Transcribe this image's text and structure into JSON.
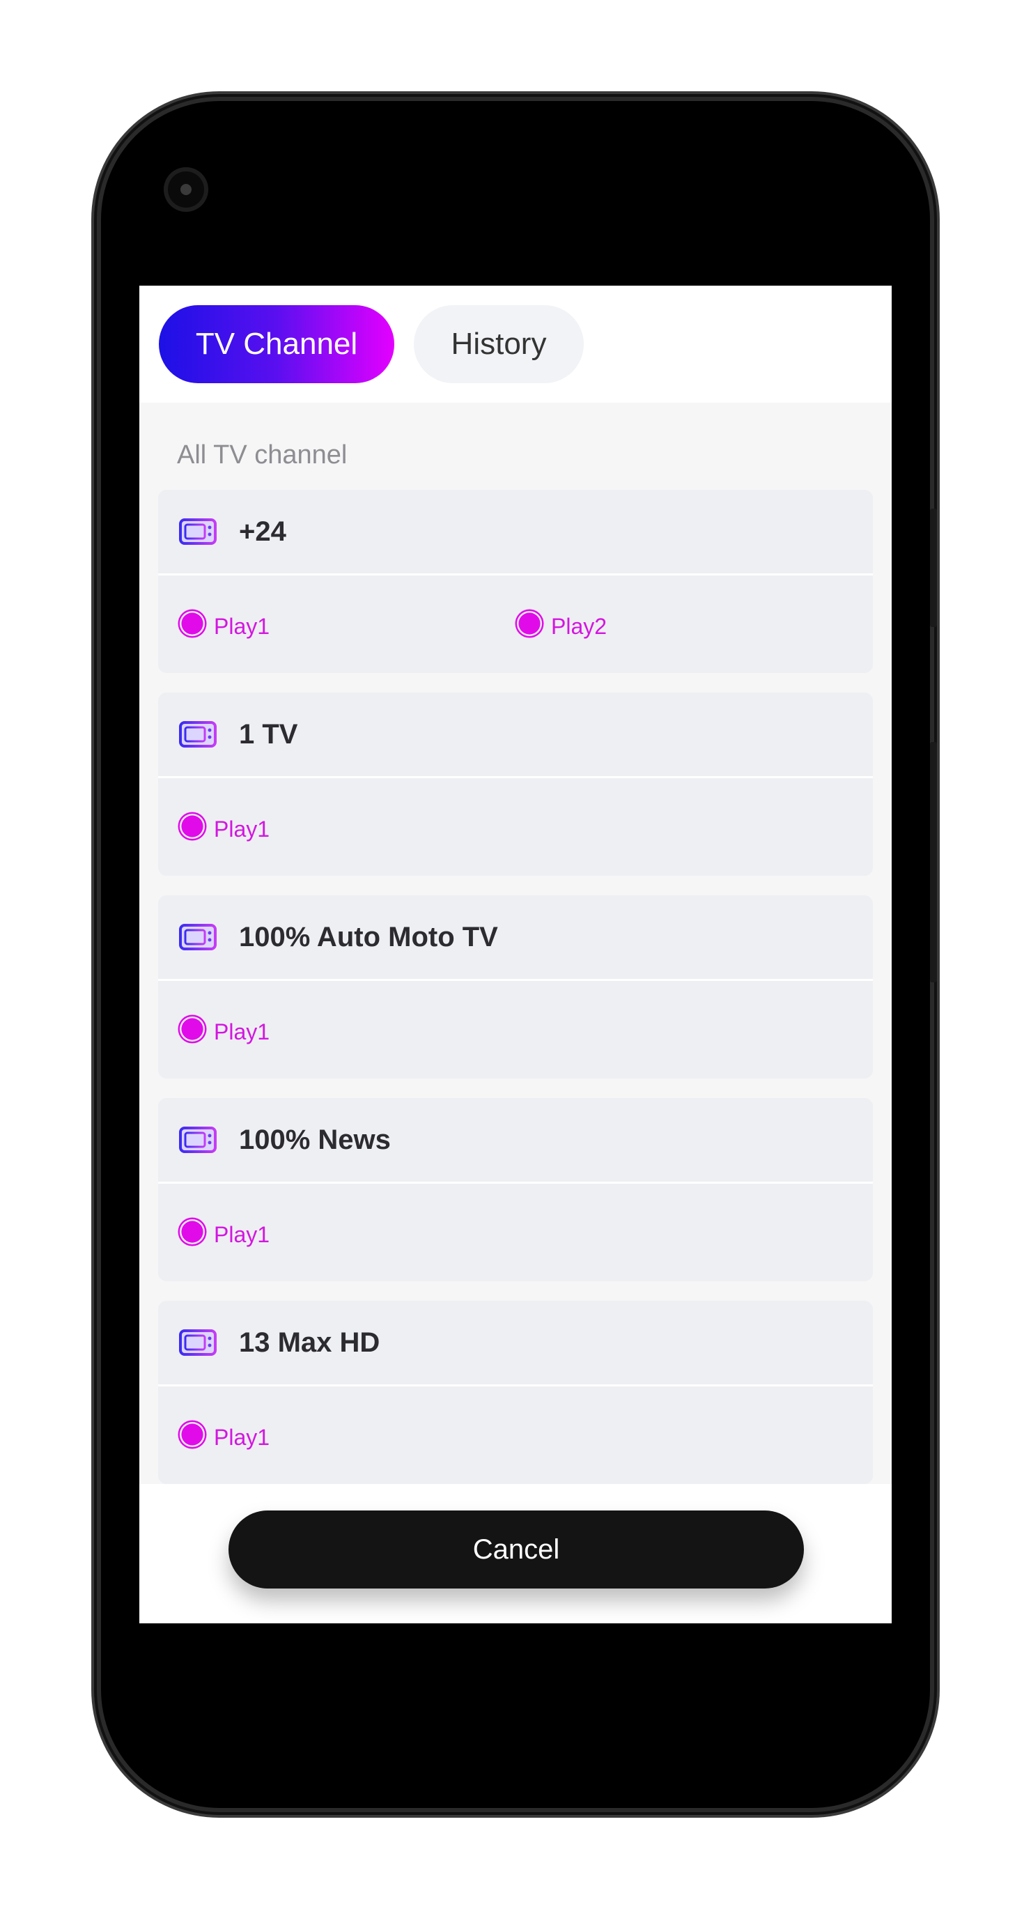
{
  "tabs": {
    "active_label": "TV Channel",
    "inactive_label": "History"
  },
  "section_title": "All TV channel",
  "channels": [
    {
      "name": "+24",
      "plays": [
        "Play1",
        "Play2"
      ]
    },
    {
      "name": "1 TV",
      "plays": [
        "Play1"
      ]
    },
    {
      "name": "100% Auto Moto TV",
      "plays": [
        "Play1"
      ]
    },
    {
      "name": "100% News",
      "plays": [
        "Play1"
      ]
    },
    {
      "name": "13 Max HD",
      "plays": [
        "Play1"
      ]
    }
  ],
  "cancel_label": "Cancel",
  "colors": {
    "accent_start": "#1c11e6",
    "accent_end": "#e400ff",
    "play": "#e10bea",
    "card_bg": "#eeeff3"
  },
  "icons": {
    "channel": "tv-icon",
    "play": "play-dot-icon"
  }
}
